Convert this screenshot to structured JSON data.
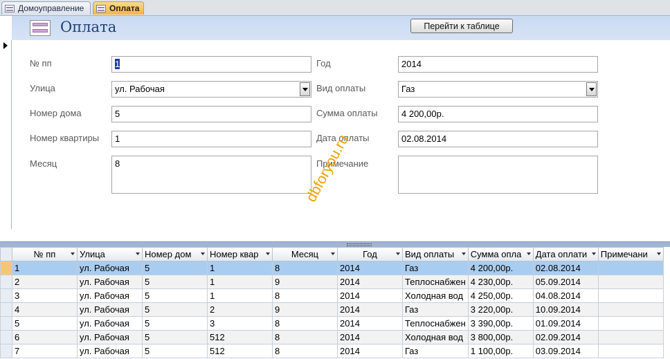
{
  "tabs": [
    {
      "label": "Домоуправление"
    },
    {
      "label": "Оплата"
    }
  ],
  "form": {
    "title": "Оплата",
    "goto_button": "Перейти к таблице",
    "labels": {
      "npp": "№ пп",
      "street": "Улица",
      "house": "Номер дома",
      "apt": "Номер квартиры",
      "month": "Месяц",
      "year": "Год",
      "paytype": "Вид оплаты",
      "sum": "Сумма оплаты",
      "date": "Дата оплаты",
      "note": "Примечание"
    },
    "values": {
      "npp": "1",
      "street": "ул.  Рабочая",
      "house": "5",
      "apt": "1",
      "month": "8",
      "year": "2014",
      "paytype": "Газ",
      "sum": "4 200,00р.",
      "date": "02.08.2014",
      "note": ""
    }
  },
  "watermark": "dbforyou.ru",
  "datasheet": {
    "columns": [
      "№ пп",
      "Улица",
      "Номер дом",
      "Номер квар",
      "Месяц",
      "Год",
      "Вид оплаты",
      "Сумма опла",
      "Дата оплати",
      "Примечани"
    ],
    "rows": [
      [
        "1",
        "ул.  Рабочая",
        "5",
        "1",
        "8",
        "2014",
        "Газ",
        "4 200,00р.",
        "02.08.2014",
        ""
      ],
      [
        "2",
        "ул.  Рабочая",
        "5",
        "1",
        "9",
        "2014",
        "Теплоснабжен",
        "4 230,00р.",
        "05.09.2014",
        ""
      ],
      [
        "3",
        "ул.  Рабочая",
        "5",
        "1",
        "8",
        "2014",
        "Холодная вод",
        "4 250,00р.",
        "04.08.2014",
        ""
      ],
      [
        "4",
        "ул.  Рабочая",
        "5",
        "2",
        "9",
        "2014",
        "Газ",
        "3 220,00р.",
        "10.09.2014",
        ""
      ],
      [
        "5",
        "ул.  Рабочая",
        "5",
        "3",
        "8",
        "2014",
        "Теплоснабжен",
        "3 390,00р.",
        "01.09.2014",
        ""
      ],
      [
        "6",
        "ул.  Рабочая",
        "5",
        "512",
        "8",
        "2014",
        "Холодная вод",
        "3 800,00р.",
        "02.09.2014",
        ""
      ],
      [
        "7",
        "ул.  Рабочая",
        "5",
        "512",
        "8",
        "2014",
        "Газ",
        "1 100,00р.",
        "03.09.2014",
        ""
      ]
    ]
  }
}
